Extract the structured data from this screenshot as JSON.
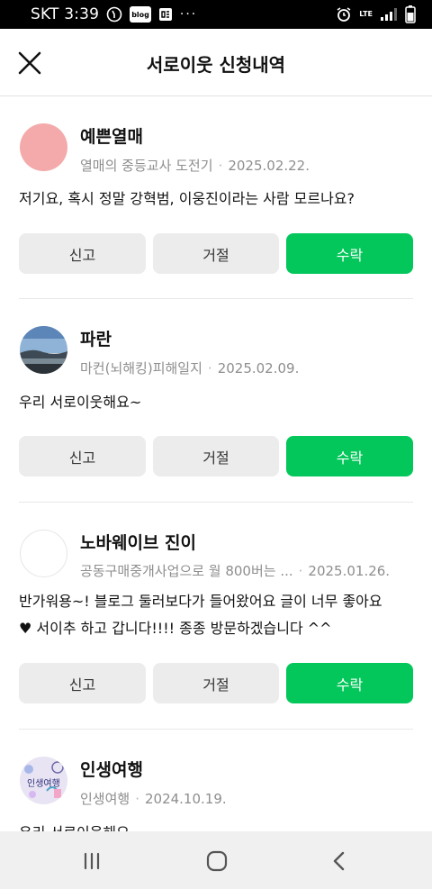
{
  "status_bar": {
    "carrier_time": "SKT 3:39",
    "blog_badge": "blog",
    "more_dots": "···",
    "network": "LTE",
    "icons": [
      "call-icon",
      "blog-icon",
      "news-icon",
      "alarm-icon",
      "signal-icon",
      "battery-icon"
    ]
  },
  "header": {
    "title": "서로이웃 신청내역",
    "close_icon": "close-icon"
  },
  "requests": [
    {
      "nickname": "예쁜열매",
      "blog": "열매의 중등교사 도전기",
      "date": "2025.02.22.",
      "message": "저기요, 혹시 정말 강혁범, 이웅진이라는 사람 모르나요?",
      "avatar_color": "#f4aaaa"
    },
    {
      "nickname": "파란",
      "blog": "마컨(뇌해킹)피해일지",
      "date": "2025.02.09.",
      "message": "우리 서로이웃해요~",
      "avatar_color": "#6f8fb0"
    },
    {
      "nickname": "노바웨이브 진이",
      "blog": "공동구매중개사업으로 월 800버는 ...",
      "date": "2025.01.26.",
      "message_line1": "반가워용~! 블로그 둘러보다가 들어왔어요 글이 너무 좋아요",
      "message_line2": "♥ 서이추 하고 갑니다!!!! 종종 방문하겠습니다 ^^",
      "avatar_color": "#ffffff"
    },
    {
      "nickname": "인생여행",
      "blog": "인생여행",
      "date": "2024.10.19.",
      "message": "우리 서로이웃해요~",
      "avatar_text": "인생여행",
      "avatar_color": "#e8e4f3"
    }
  ],
  "buttons": {
    "report": "신고",
    "reject": "거절",
    "accept": "수락"
  },
  "colors": {
    "accent": "#03c75a",
    "secondary_button": "#ececec"
  },
  "nav_bar": {
    "icons": [
      "recent-apps-icon",
      "home-icon",
      "back-icon"
    ]
  }
}
